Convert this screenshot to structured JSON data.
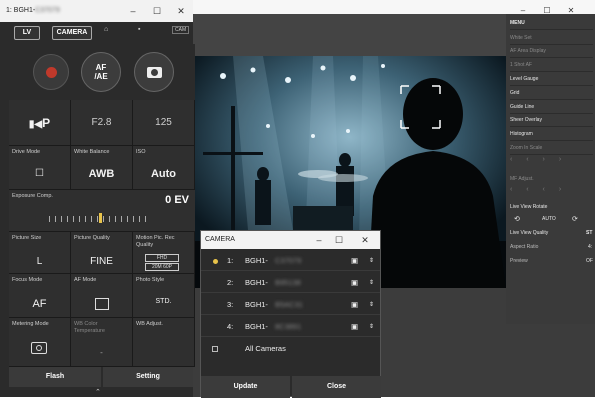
{
  "left_window": {
    "title": "1: BGH1-",
    "title_blur": "C37079",
    "controls": [
      "–",
      "☐",
      "✕"
    ],
    "lv_label": "LV",
    "camera_label": "CAMERA",
    "tally_label": "CAM",
    "afae_label": "AF\n/AE",
    "cells": [
      {
        "label": "",
        "value": "P"
      },
      {
        "label": "",
        "value": "F2.8"
      },
      {
        "label": "",
        "value": "125"
      },
      {
        "label": "Drive Mode",
        "value": "☐"
      },
      {
        "label": "White Balance",
        "value": "AWB"
      },
      {
        "label": "ISO",
        "value": "Auto"
      }
    ],
    "exposure": {
      "label": "Exposure Comp.",
      "value": "0 EV"
    },
    "cells2": [
      {
        "label": "Picture Size",
        "value": "L"
      },
      {
        "label": "Picture Quality",
        "value": "FINE"
      },
      {
        "label": "Motion Pic. Rec Quality",
        "value": "FHD",
        "sub": "20M  60P"
      },
      {
        "label": "Focus Mode",
        "value": "AF"
      },
      {
        "label": "AF Mode",
        "value": ""
      },
      {
        "label": "Photo Style",
        "value": "STD."
      },
      {
        "label": "Metering Mode",
        "value": ""
      },
      {
        "label": "WB Color Temperature",
        "value": "-"
      },
      {
        "label": "WB Adjust.",
        "value": ""
      }
    ],
    "flash_label": "Flash",
    "setting_label": "Setting"
  },
  "main_window": {
    "controls": [
      "–",
      "☐",
      "✕"
    ]
  },
  "menu": {
    "title": "MENU",
    "items": [
      {
        "label": "White Set",
        "dim": true
      },
      {
        "label": "AF Area Display",
        "dim": true
      },
      {
        "label": "1 Shot AF",
        "dim": true
      },
      {
        "label": "Level Gauge",
        "dim": false
      },
      {
        "label": "Grid",
        "dim": false
      },
      {
        "label": "Guide Line",
        "dim": false
      },
      {
        "label": "Sheer Overlay",
        "dim": false
      },
      {
        "label": "Histogram",
        "dim": false
      },
      {
        "label": "Zoom In Scale",
        "dim": true
      }
    ],
    "mf_label": "MF Adjust.",
    "rotate_label": "Live View Rotate",
    "auto_label": "AUTO",
    "quality_label": "Live View Quality",
    "quality_value": "ST",
    "aspect_label": "Aspect Ratio",
    "aspect_value": "4:",
    "preview_label": "Preview",
    "preview_value": "OF"
  },
  "dialog": {
    "title": "CAMERA",
    "controls": [
      "–",
      "☐",
      "✕"
    ],
    "cameras": [
      {
        "num": "1:",
        "name": "BGH1-",
        "blur": "C37079",
        "active": true
      },
      {
        "num": "2:",
        "name": "BGH1-",
        "blur": "B95138",
        "active": false
      },
      {
        "num": "3:",
        "name": "BGH1-",
        "blur": "B5AC31",
        "active": false
      },
      {
        "num": "4:",
        "name": "BGH1-",
        "blur": "8C3891",
        "active": false
      }
    ],
    "all_label": "All Cameras",
    "update_label": "Update",
    "close_label": "Close"
  },
  "colors": {
    "accent": "#e8c34a",
    "record": "#c0392b",
    "dark": "#2b2b2b"
  }
}
